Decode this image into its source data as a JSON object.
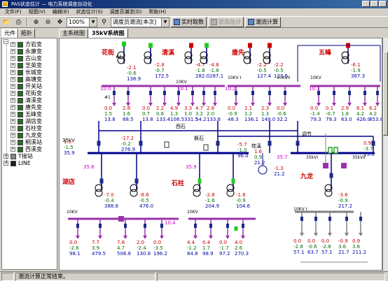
{
  "window": {
    "title": "PAS状态估计 — 电力系统调度自动化"
  },
  "menu": [
    "文件(F)",
    "视图(V)",
    "编辑(E)",
    "状态估计(S)",
    "调度员潮流(D)",
    "帮助(H)"
  ],
  "toolbar": {
    "zoom": "100%",
    "mode": "调度员潮流[本次]",
    "btn_realtime": "实时取数",
    "btn_state_est": "状态估计",
    "btn_power_flow": "潮流计算"
  },
  "left_tabs": {
    "elements": "元件",
    "topology": "拓扑"
  },
  "tree": {
    "items": [
      "方岩变",
      "永康变",
      "古山变",
      "芝英变",
      "长城变",
      "高塘变",
      "开关站",
      "花街变",
      "清溪变",
      "唐先变",
      "五峰变",
      "湖店变",
      "石柱变",
      "九龙变",
      "桐溪站",
      "西溪变",
      "T接站"
    ],
    "line_label": "LINE"
  },
  "main_tabs": {
    "t1": "主系统图",
    "t2": "35kV系统图"
  },
  "status": {
    "message": "潮流计算正常结束。"
  },
  "diagram": {
    "station_huajie": "花街",
    "station_qingxi": "清溪",
    "station_tangxian": "唐先",
    "station_wufeng": "五峰",
    "station_hudian": "湖店",
    "station_shizhu": "石柱",
    "station_jiulong": "九龙",
    "lbl_xishi": "西石",
    "lbl_fengshi": "枫石",
    "lbl_tiaojie": "调节",
    "lbl_guixi": "桂溪",
    "bus_10kv": "10KV",
    "bus_35kv": "35kV",
    "bus_10kvI": "10KV I",
    "bus_10kvII": "10KVII",
    "bus_35kvI": "35kVI",
    "bus_35kvII": "35kVII",
    "huajie_tx": [
      "-2.1",
      "-0.6",
      "138.9"
    ],
    "huajie_tx_num": "#1",
    "qingxi_tx1": [
      "-2.8",
      "-0.7",
      "172.5"
    ],
    "qingxi_tx2": [
      "-4.7",
      "-1.8",
      "282.0"
    ],
    "qingxi_tx3": [
      "-4.8",
      "-1.8",
      "287.1"
    ],
    "tangxian_tx1": [
      "-2.2",
      "-0.5",
      "127.4"
    ],
    "tangxian_tx2": [
      "-2.2",
      "-0.5",
      "127.6"
    ],
    "wufeng_tx": [
      "-6.1",
      "-1.9",
      "367.3"
    ],
    "hudian_tx1": [
      "-7.0",
      "-0.4",
      "388.8"
    ],
    "hudian_tx2": [
      "-8.6",
      "-0.5",
      "476.0"
    ],
    "shizhu_tx1": [
      "-2.8",
      "-1.6",
      "204.9"
    ],
    "shizhu_tx2": [
      "-1.6",
      "-0.9",
      "104.6"
    ],
    "jiulong_tx": [
      "-3.6",
      "-0.9",
      "217.2"
    ],
    "bus_val_100": "10.0",
    "bus_val_101": "10.1",
    "bus_val_104": "10.4",
    "bus_val_102": "10.2",
    "bus_35_358": "35.8",
    "bus_35_357": "35.7",
    "bus_35_359": "35.9",
    "bus_35_360": "36.0",
    "line_top_left": [
      "1.6",
      "-1.5",
      "35.9"
    ],
    "line_mid": [
      "-17.2",
      "-0.2",
      "276.9"
    ],
    "line_r1": [
      "-5.7",
      "-1.0",
      "96.0"
    ],
    "line_r2": [
      "1.6",
      "0.9",
      "21.2"
    ],
    "line_right": [
      "0.9",
      "-3.7",
      "15.0"
    ],
    "line_shizhu_cap": [
      "-1.3",
      "21.2"
    ],
    "feed_huajie": [
      [
        "0.0",
        "1.5",
        "13.8"
      ],
      [
        "2.8",
        "1.6",
        "88.5"
      ]
    ],
    "feed_qingxi": [
      [
        "0.0",
        "0.7",
        "13.8"
      ],
      [
        "2.2",
        "0.6",
        "133.4"
      ],
      [
        "4.9",
        "1.3",
        "108.5"
      ],
      [
        "3.3",
        "1.0",
        "331.5"
      ],
      [
        "4.7",
        "3.2",
        "54.2"
      ],
      [
        "2.8",
        "2.0",
        "133.6"
      ]
    ],
    "feed_tangxian": [
      [
        "0.0",
        "-0.9",
        "48.3"
      ],
      [
        "2.1",
        "1.2",
        "136.1"
      ],
      [
        "2.3",
        "1.3",
        "149.0"
      ],
      [
        "0.0",
        "-0.6",
        "32.2"
      ]
    ],
    "feed_wufeng": [
      [
        "0.0",
        "-1.4",
        "79.3"
      ],
      [
        "0.1",
        "-0.7",
        "79.3"
      ],
      [
        "2.9",
        "1.8",
        "63.0"
      ],
      [
        "6.1",
        "4.2",
        "426.0"
      ],
      [
        "6.2",
        "4.2",
        "453.8"
      ]
    ],
    "feed_hudian": [
      [
        "0.0",
        "-2.6",
        "98.1"
      ],
      [
        "7.7",
        "3.9",
        "479.5"
      ],
      [
        "7.8",
        "4.7",
        "506.6"
      ],
      [
        "2.0",
        "-2.4",
        "130.8"
      ],
      [
        "0.0",
        "-3.5",
        "196.2"
      ]
    ],
    "feed_shizhu": [
      [
        "4.4",
        "-1.2",
        "84.8"
      ],
      [
        "0.4",
        "1.7",
        "98.9"
      ],
      [
        "0.0",
        "-1.7",
        "97.2"
      ],
      [
        "4.0",
        "2.6",
        "270.3"
      ]
    ],
    "feed_jiulong": [
      [
        "0.0",
        "-2.8",
        "57.1"
      ],
      [
        "0.0",
        "-0.6",
        "63.7"
      ],
      [
        "0.0",
        "-2.8",
        "57.1"
      ],
      [
        "-0.9",
        "3.6",
        "21.7"
      ],
      [
        "0.9",
        "3.6",
        "211.2"
      ]
    ],
    "breaker_labels": [
      "#1",
      "#2",
      "#3"
    ]
  },
  "colors": {
    "bus": "#9933aa",
    "breaker": "#1a2a8a",
    "flow_red": "#cc0000",
    "flow_green": "#007000",
    "flow_blue": "#0000aa",
    "station_red": "#cc0000",
    "bus_35": "#00008a",
    "voltage": "#cc00cc"
  }
}
